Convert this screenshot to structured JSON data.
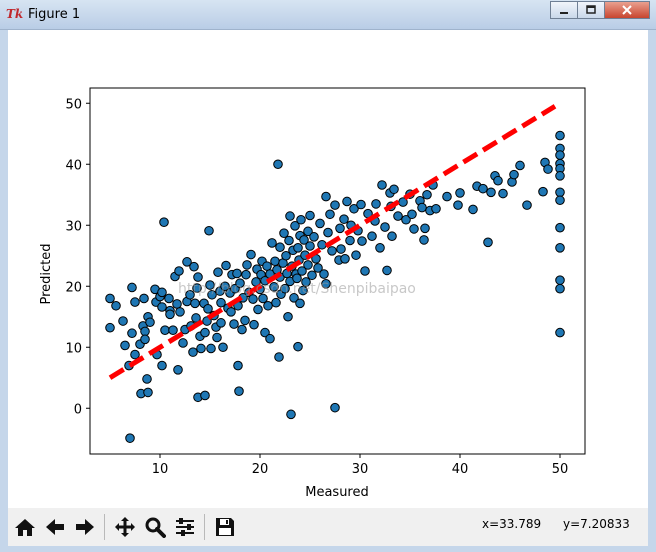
{
  "window": {
    "title": "Figure 1",
    "app_icon": "Tk",
    "controls": [
      "minimize-icon",
      "maximize-icon",
      "close-icon"
    ]
  },
  "toolbar": {
    "buttons": [
      "home-icon",
      "back-arrow-icon",
      "forward-arrow-icon",
      "pan-move-icon",
      "zoom-magnifier-icon",
      "subplots-config-icon",
      "save-floppy-icon"
    ],
    "coord_x": "x=33.789",
    "coord_y": "y=7.20833"
  },
  "watermark": "http://blog.csdn.net/Shenpibaipao",
  "colors": {
    "point_fill": "#1f77b4",
    "point_edge": "#000000",
    "fit_line": "#ff0000"
  },
  "chart_data": {
    "type": "scatter",
    "xlabel": "Measured",
    "ylabel": "Predicted",
    "xlim": [
      3,
      52.5
    ],
    "ylim": [
      -7.5,
      52.5
    ],
    "xticks": [
      10,
      20,
      30,
      40,
      50
    ],
    "yticks": [
      0,
      10,
      20,
      30,
      40,
      50
    ],
    "grid": false,
    "fit_line": {
      "x": [
        5,
        49.5
      ],
      "y": [
        5,
        49.5
      ],
      "style": "dashed"
    },
    "points": [
      [
        5.0,
        18.0
      ],
      [
        5.0,
        13.2
      ],
      [
        5.6,
        16.8
      ],
      [
        6.3,
        14.3
      ],
      [
        6.5,
        10.3
      ],
      [
        6.9,
        7.0
      ],
      [
        7.0,
        -4.9
      ],
      [
        7.2,
        19.8
      ],
      [
        7.2,
        12.3
      ],
      [
        7.5,
        8.8
      ],
      [
        7.5,
        17.4
      ],
      [
        8.0,
        10.5
      ],
      [
        8.1,
        2.4
      ],
      [
        8.3,
        13.5
      ],
      [
        8.4,
        18.0
      ],
      [
        8.5,
        12.6
      ],
      [
        8.5,
        11.3
      ],
      [
        8.7,
        4.8
      ],
      [
        8.8,
        15.0
      ],
      [
        8.8,
        2.6
      ],
      [
        9.0,
        14.1
      ],
      [
        9.6,
        17.4
      ],
      [
        9.5,
        19.5
      ],
      [
        9.7,
        8.8
      ],
      [
        10.0,
        18.3
      ],
      [
        10.2,
        19.0
      ],
      [
        10.2,
        16.6
      ],
      [
        10.2,
        7.0
      ],
      [
        10.4,
        30.5
      ],
      [
        10.5,
        12.8
      ],
      [
        10.9,
        18.0
      ],
      [
        11.0,
        16.0
      ],
      [
        11.0,
        15.4
      ],
      [
        11.3,
        12.8
      ],
      [
        11.5,
        21.6
      ],
      [
        11.7,
        17.1
      ],
      [
        11.8,
        6.3
      ],
      [
        11.9,
        22.5
      ],
      [
        12.0,
        15.8
      ],
      [
        12.3,
        10.7
      ],
      [
        12.5,
        12.9
      ],
      [
        12.7,
        24.0
      ],
      [
        12.7,
        17.5
      ],
      [
        13.0,
        18.6
      ],
      [
        13.1,
        13.5
      ],
      [
        13.3,
        9.2
      ],
      [
        13.4,
        23.2
      ],
      [
        13.5,
        17.2
      ],
      [
        13.6,
        14.8
      ],
      [
        13.7,
        19.7
      ],
      [
        13.8,
        21.5
      ],
      [
        13.8,
        1.8
      ],
      [
        14.0,
        11.8
      ],
      [
        14.1,
        9.8
      ],
      [
        14.4,
        17.2
      ],
      [
        14.5,
        2.1
      ],
      [
        14.5,
        12.4
      ],
      [
        14.7,
        14.3
      ],
      [
        14.8,
        16.3
      ],
      [
        14.9,
        29.1
      ],
      [
        15.0,
        20.2
      ],
      [
        15.1,
        9.8
      ],
      [
        15.2,
        18.6
      ],
      [
        15.4,
        15.2
      ],
      [
        15.6,
        13.3
      ],
      [
        15.7,
        11.6
      ],
      [
        15.8,
        22.3
      ],
      [
        16.0,
        19.2
      ],
      [
        16.1,
        14.0
      ],
      [
        16.1,
        17.3
      ],
      [
        16.3,
        10.0
      ],
      [
        16.5,
        20.0
      ],
      [
        16.6,
        23.4
      ],
      [
        16.8,
        16.4
      ],
      [
        17.0,
        18.9
      ],
      [
        17.1,
        15.8
      ],
      [
        17.2,
        21.9
      ],
      [
        17.4,
        13.8
      ],
      [
        17.5,
        19.6
      ],
      [
        17.7,
        22.1
      ],
      [
        17.8,
        16.8
      ],
      [
        17.8,
        7.0
      ],
      [
        17.9,
        2.8
      ],
      [
        18.0,
        20.5
      ],
      [
        18.2,
        12.9
      ],
      [
        18.3,
        18.1
      ],
      [
        18.5,
        14.4
      ],
      [
        18.6,
        21.9
      ],
      [
        18.7,
        23.5
      ],
      [
        18.9,
        19.0
      ],
      [
        19.1,
        25.2
      ],
      [
        19.3,
        17.9
      ],
      [
        19.4,
        13.7
      ],
      [
        19.6,
        20.7
      ],
      [
        19.7,
        22.8
      ],
      [
        19.8,
        16.2
      ],
      [
        20.0,
        19.5
      ],
      [
        20.1,
        21.9
      ],
      [
        20.2,
        24.1
      ],
      [
        20.3,
        18.0
      ],
      [
        20.5,
        12.4
      ],
      [
        20.5,
        20.9
      ],
      [
        20.7,
        23.3
      ],
      [
        20.8,
        16.8
      ],
      [
        21.0,
        22.0
      ],
      [
        21.0,
        11.4
      ],
      [
        21.2,
        27.1
      ],
      [
        21.4,
        19.9
      ],
      [
        21.5,
        24.1
      ],
      [
        21.6,
        17.3
      ],
      [
        21.7,
        22.7
      ],
      [
        21.8,
        40.0
      ],
      [
        21.9,
        8.4
      ],
      [
        22.0,
        26.4
      ],
      [
        22.0,
        21.5
      ],
      [
        22.1,
        18.7
      ],
      [
        22.3,
        23.8
      ],
      [
        22.4,
        28.7
      ],
      [
        22.5,
        19.6
      ],
      [
        22.6,
        25.0
      ],
      [
        22.7,
        22.1
      ],
      [
        22.8,
        15.0
      ],
      [
        22.9,
        27.5
      ],
      [
        23.0,
        20.8
      ],
      [
        23.0,
        31.5
      ],
      [
        23.1,
        -1.0
      ],
      [
        23.2,
        23.3
      ],
      [
        23.3,
        25.9
      ],
      [
        23.4,
        18.1
      ],
      [
        23.5,
        29.9
      ],
      [
        23.6,
        22.0
      ],
      [
        23.7,
        21.3
      ],
      [
        23.8,
        10.1
      ],
      [
        23.8,
        26.3
      ],
      [
        23.9,
        24.3
      ],
      [
        24.0,
        28.3
      ],
      [
        24.0,
        17.2
      ],
      [
        24.1,
        30.9
      ],
      [
        24.2,
        22.5
      ],
      [
        24.3,
        19.3
      ],
      [
        24.4,
        27.6
      ],
      [
        24.5,
        25.1
      ],
      [
        24.6,
        20.7
      ],
      [
        24.8,
        29.0
      ],
      [
        24.8,
        23.5
      ],
      [
        25.0,
        31.6
      ],
      [
        25.0,
        26.6
      ],
      [
        25.2,
        21.8
      ],
      [
        25.4,
        28.1
      ],
      [
        25.6,
        24.5
      ],
      [
        25.8,
        23.0
      ],
      [
        26.0,
        30.3
      ],
      [
        26.2,
        26.8
      ],
      [
        26.4,
        22.0
      ],
      [
        26.6,
        34.7
      ],
      [
        26.6,
        20.4
      ],
      [
        26.8,
        28.8
      ],
      [
        27.0,
        31.8
      ],
      [
        27.2,
        25.8
      ],
      [
        27.5,
        0.1
      ],
      [
        27.5,
        33.3
      ],
      [
        27.9,
        24.3
      ],
      [
        28.0,
        29.5
      ],
      [
        28.1,
        26.1
      ],
      [
        28.4,
        31.0
      ],
      [
        28.5,
        24.5
      ],
      [
        28.7,
        33.9
      ],
      [
        29.0,
        27.5
      ],
      [
        29.1,
        30.0
      ],
      [
        29.4,
        32.7
      ],
      [
        29.6,
        25.1
      ],
      [
        29.8,
        29.1
      ],
      [
        30.1,
        33.4
      ],
      [
        30.2,
        27.4
      ],
      [
        30.5,
        22.5
      ],
      [
        30.8,
        31.9
      ],
      [
        31.2,
        28.2
      ],
      [
        31.5,
        30.7
      ],
      [
        31.6,
        33.5
      ],
      [
        32.0,
        26.3
      ],
      [
        32.2,
        36.6
      ],
      [
        32.5,
        29.7
      ],
      [
        32.7,
        22.6
      ],
      [
        33.0,
        35.3
      ],
      [
        33.1,
        33.1
      ],
      [
        33.2,
        28.2
      ],
      [
        33.4,
        35.9
      ],
      [
        33.8,
        31.5
      ],
      [
        34.3,
        33.8
      ],
      [
        34.6,
        30.9
      ],
      [
        35.0,
        35.1
      ],
      [
        35.2,
        31.8
      ],
      [
        35.4,
        29.4
      ],
      [
        36.0,
        34.0
      ],
      [
        36.2,
        32.9
      ],
      [
        36.4,
        27.6
      ],
      [
        36.5,
        29.5
      ],
      [
        36.7,
        35.0
      ],
      [
        37.0,
        32.4
      ],
      [
        37.3,
        36.6
      ],
      [
        37.6,
        32.7
      ],
      [
        38.7,
        34.7
      ],
      [
        39.8,
        33.3
      ],
      [
        40.0,
        35.3
      ],
      [
        41.3,
        32.6
      ],
      [
        41.7,
        36.4
      ],
      [
        42.3,
        36.0
      ],
      [
        42.8,
        27.2
      ],
      [
        43.1,
        35.4
      ],
      [
        43.5,
        38.1
      ],
      [
        43.8,
        37.3
      ],
      [
        44.3,
        35.2
      ],
      [
        45.2,
        37.1
      ],
      [
        45.4,
        38.3
      ],
      [
        46.0,
        39.8
      ],
      [
        46.7,
        33.3
      ],
      [
        48.3,
        35.5
      ],
      [
        48.5,
        40.3
      ],
      [
        48.8,
        39.2
      ],
      [
        50.0,
        44.7
      ],
      [
        50.0,
        42.6
      ],
      [
        50.0,
        41.5
      ],
      [
        50.0,
        40.1
      ],
      [
        50.0,
        39.3
      ],
      [
        50.0,
        38.1
      ],
      [
        50.0,
        35.4
      ],
      [
        50.0,
        34.1
      ],
      [
        50.0,
        29.6
      ],
      [
        50.0,
        26.3
      ],
      [
        50.0,
        21.0
      ],
      [
        50.0,
        19.6
      ],
      [
        50.0,
        12.4
      ]
    ]
  }
}
